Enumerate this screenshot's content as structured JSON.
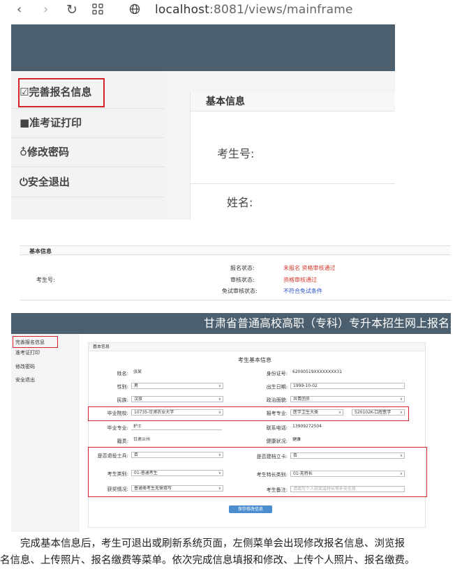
{
  "browser": {
    "back_icon": "chevron-left-icon",
    "forward_icon": "chevron-right-icon",
    "reload_icon": "reload-icon",
    "apps_icon": "grid-icon",
    "site_icon": "globe-icon",
    "url_host": "localhost",
    "url_rest": ":8081/views/mainframe"
  },
  "shot1": {
    "menu": [
      {
        "icon": "edit-icon",
        "label": "☑完善报名信息"
      },
      {
        "icon": "printer-icon",
        "label": "■准考证打印"
      },
      {
        "icon": "key-icon",
        "label": "♁修改密码"
      },
      {
        "icon": "power-icon",
        "label": "⏻安全退出"
      }
    ],
    "panel_title": "基本信息",
    "label_exam_no": "考生号:",
    "label_name": "姓名:",
    "colors": {
      "header": "#4b5f6e",
      "highlight": "#d6242a"
    }
  },
  "shot2": {
    "section_title": "基本信息",
    "exam_no_label": "考生号:",
    "status_rows": [
      {
        "label": "报名状态:",
        "value": "未报名 资格审核通过",
        "color": "red"
      },
      {
        "label": "审核状态:",
        "value": "资格审核通过",
        "color": "red"
      },
      {
        "label": "免试审核状态:",
        "value": "不符合免试条件",
        "color": "blue"
      }
    ]
  },
  "shot3": {
    "header_title": "甘肃省普通高校高职（专科）专升本招生网上报名系",
    "menu": [
      "完善报名信息",
      "准考证打印",
      "修改密码",
      "安全退出"
    ],
    "form_title": "基本信息",
    "form_heading": "考生基本信息",
    "fields": {
      "name_label": "姓名:",
      "name_value": "张某",
      "id_label": "身份证号:",
      "id_value": "62000519XXXXXXXX31",
      "gender_label": "性别:",
      "gender_value": "男",
      "birth_label": "出生日期:",
      "birth_value": "1999-10-02",
      "ethnic_label": "民族:",
      "ethnic_value": "汉族",
      "political_label": "政治面貌:",
      "political_value": "共青团员",
      "school_label": "毕业院校:",
      "school_value": "10735-甘肃农业大学",
      "major_label": "报考专业:",
      "major_value1": "医学卫生大类",
      "major_value2": "520102K-口腔医学",
      "major_no_label": "毕业专业:",
      "major_no_value": "护士",
      "phone_label": "联系电话:",
      "phone_value": "13909272504",
      "origin_label": "籍贯:",
      "origin_value": "甘肃兰州",
      "health_label": "健康状况:",
      "health_value": "健康",
      "retired_label": "是否退役士兵:",
      "retired_value": "否",
      "poverty_label": "是否建档立卡:",
      "poverty_value": "否",
      "exempt_label": "考生类别:",
      "exempt_value": "01-普通考生",
      "special_label": "考生特长类别:",
      "special_value": "01-无特长",
      "award_label": "获奖情况:",
      "award_value": "普通类考生无需填写",
      "remark_label": "考生备注:",
      "remark_placeholder": "请填写个人获奖或特长等补充信息"
    },
    "submit_label": "保存修改信息"
  },
  "caption": {
    "line1": "完成基本信息后，考生可退出或刷新系统页面，左侧菜单会出现修改报名信息、浏览报",
    "line2": "名信息、上传照片、报名缴费等菜单。依次完成信息填报和修改、上传个人照片、报名缴费。"
  }
}
